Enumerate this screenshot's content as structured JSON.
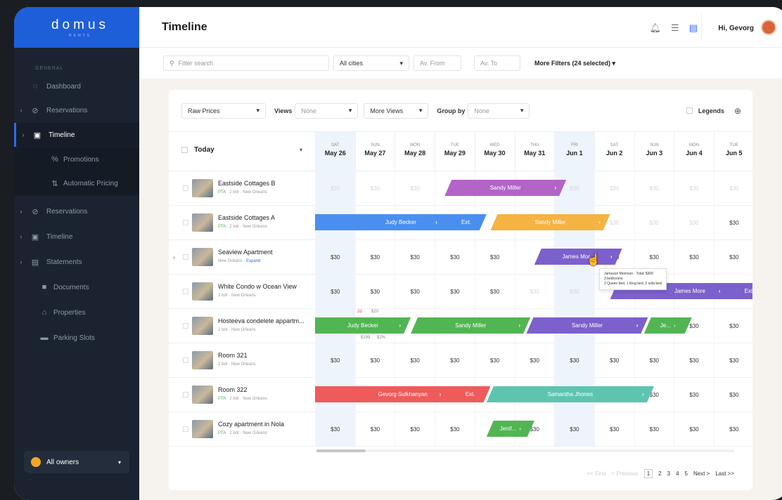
{
  "brand": {
    "name": "domus",
    "sub": "RENTS"
  },
  "sidebar": {
    "section_label": "GENERAL",
    "items": [
      {
        "label": "Dashboard",
        "icon": "dashboard-icon"
      },
      {
        "label": "Reservations",
        "icon": "reservations-icon"
      },
      {
        "label": "Timeline",
        "icon": "calendar-icon"
      },
      {
        "label": "Promotions",
        "icon": "percent-icon"
      },
      {
        "label": "Automatic Pricing",
        "icon": "pricing-icon"
      },
      {
        "label": "Reservations",
        "icon": "reservations-icon"
      },
      {
        "label": "Timeline",
        "icon": "calendar-icon"
      },
      {
        "label": "Statements",
        "icon": "statements-icon"
      },
      {
        "label": "Documents",
        "icon": "folder-icon"
      },
      {
        "label": "Properties",
        "icon": "home-icon"
      },
      {
        "label": "Parking Slots",
        "icon": "car-icon"
      }
    ],
    "owners": "All owners"
  },
  "header": {
    "title": "Timeline",
    "greeting": "Hi, Gevorg"
  },
  "filters": {
    "search_placeholder": "Filter search",
    "city": "All cities",
    "av_from": "Av. From",
    "av_to": "Av. To",
    "more": "More Filters (24 selected)"
  },
  "controls": {
    "raw_prices": "Raw Prices",
    "views_label": "Views",
    "views_value": "None",
    "more_views": "More Views",
    "group_label": "Group by",
    "group_value": "None",
    "legends": "Legends"
  },
  "grid": {
    "today": "Today",
    "days": [
      {
        "dow": "SAT",
        "date": "May 26"
      },
      {
        "dow": "SUN",
        "date": "May 27"
      },
      {
        "dow": "MON",
        "date": "May 28"
      },
      {
        "dow": "TUE",
        "date": "May 29"
      },
      {
        "dow": "WED",
        "date": "May 30"
      },
      {
        "dow": "THU",
        "date": "May 31"
      },
      {
        "dow": "FRI",
        "date": "Jun 1"
      },
      {
        "dow": "SAT",
        "date": "Jun 2"
      },
      {
        "dow": "SUN",
        "date": "Jun 3"
      },
      {
        "dow": "MON",
        "date": "Jun 4"
      },
      {
        "dow": "TUE",
        "date": "Jun 5"
      }
    ],
    "price": "$30",
    "rows": [
      {
        "name": "Eastside Cottages B",
        "pta": "PTA",
        "meta": " · 2 bdr · New Orleans"
      },
      {
        "name": "Eastside Cottages A",
        "pta": "PTA",
        "meta": " · 2 bdr · New Orleans"
      },
      {
        "name": "Seaview Apartment",
        "pta": "",
        "meta": "New Orleans · ",
        "expand": "Expand"
      },
      {
        "name": "White Condo w Ocean View",
        "pta": "",
        "meta": "2 bdr · New Orleans"
      },
      {
        "name": "Hosteeva condelete appartm...",
        "pta": "",
        "meta": "2 bdr · New Orleans"
      },
      {
        "name": "Room 321",
        "pta": "",
        "meta": "2 bdr · New Orleans"
      },
      {
        "name": "Room 322",
        "pta": "PTA",
        "meta": " · 2 bdr · New Orleans"
      },
      {
        "name": "Cozy apartment in Nola",
        "pta": "PTA",
        "meta": " · 2 bdr · New Orleans"
      }
    ],
    "bookings": {
      "sandy": "Sandy Miller",
      "judy": "Judy Becker",
      "james_short": "James Mor...",
      "james": "James More",
      "gevorg": "Gevorg Sulkhanyan",
      "samantha": "Samantha Jhones",
      "jenif": "Jenif...",
      "je": "Je...",
      "ext": "Ext."
    },
    "tooltip": [
      "Jameson Morrison · Total: $300",
      "3 bedrooms",
      "2 Queen bed, 1 King bed, 2 sofa bed"
    ],
    "minis": {
      "a": "2d",
      "b": "$20",
      "c": "$199",
      "d": "$2%"
    }
  },
  "pager": {
    "first": "<< First",
    "prev": "< Previous",
    "pages": [
      "1",
      "2",
      "3",
      "4",
      "5"
    ],
    "next": "Next >",
    "last": "Last >>"
  },
  "colors": {
    "purple": "#b264c7",
    "blue": "#4a8ff0",
    "orange": "#f5b342",
    "violet": "#7c60cc",
    "green": "#52b553",
    "red": "#ef5a5a",
    "teal": "#5ec4b0",
    "brand": "#1e5fd9"
  }
}
